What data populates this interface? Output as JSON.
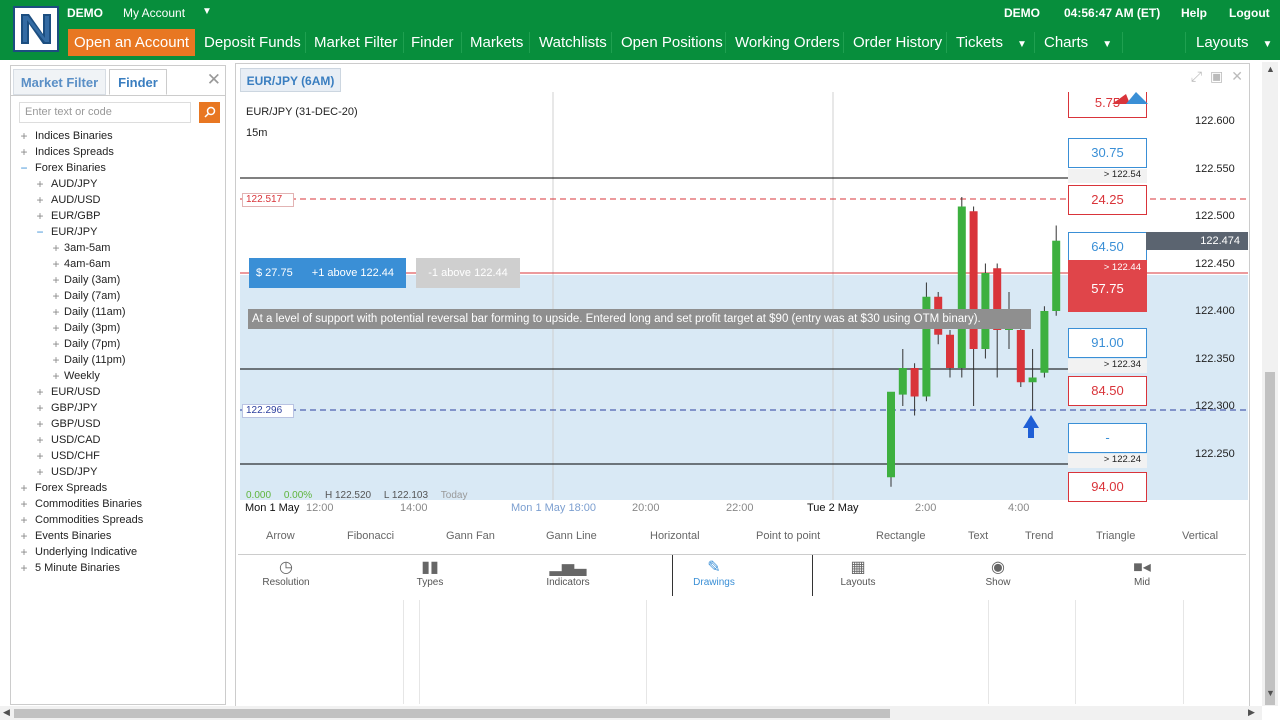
{
  "header": {
    "logo_icon": "nadex-n-logo",
    "demo_left": "DEMO",
    "my_account": "My Account",
    "demo_right": "DEMO",
    "time": "04:56:47 AM (ET)",
    "help": "Help",
    "logout": "Logout"
  },
  "nav": {
    "open_account": "Open an Account",
    "deposit": "Deposit Funds",
    "market_filter": "Market Filter",
    "finder": "Finder",
    "markets": "Markets",
    "watchlists": "Watchlists",
    "open_positions": "Open Positions",
    "working_orders": "Working Orders",
    "order_history": "Order History",
    "tickets": "Tickets",
    "charts": "Charts",
    "layouts": "Layouts"
  },
  "sidebar": {
    "tab_market_filter": "Market Filter",
    "tab_finder": "Finder",
    "search_placeholder": "Enter text or code",
    "tree": [
      {
        "label": "Indices Binaries",
        "level": 0,
        "exp": "+"
      },
      {
        "label": "Indices Spreads",
        "level": 0,
        "exp": "+"
      },
      {
        "label": "Forex Binaries",
        "level": 0,
        "exp": "−"
      },
      {
        "label": "AUD/JPY",
        "level": 1,
        "exp": "+"
      },
      {
        "label": "AUD/USD",
        "level": 1,
        "exp": "+"
      },
      {
        "label": "EUR/GBP",
        "level": 1,
        "exp": "+"
      },
      {
        "label": "EUR/JPY",
        "level": 1,
        "exp": "−"
      },
      {
        "label": "3am-5am",
        "level": 2,
        "exp": "+"
      },
      {
        "label": "4am-6am",
        "level": 2,
        "exp": "+"
      },
      {
        "label": "Daily (3am)",
        "level": 2,
        "exp": "+"
      },
      {
        "label": "Daily (7am)",
        "level": 2,
        "exp": "+"
      },
      {
        "label": "Daily (11am)",
        "level": 2,
        "exp": "+"
      },
      {
        "label": "Daily (3pm)",
        "level": 2,
        "exp": "+"
      },
      {
        "label": "Daily (7pm)",
        "level": 2,
        "exp": "+"
      },
      {
        "label": "Daily (11pm)",
        "level": 2,
        "exp": "+"
      },
      {
        "label": "Weekly",
        "level": 2,
        "exp": "+"
      },
      {
        "label": "EUR/USD",
        "level": 1,
        "exp": "+"
      },
      {
        "label": "GBP/JPY",
        "level": 1,
        "exp": "+"
      },
      {
        "label": "GBP/USD",
        "level": 1,
        "exp": "+"
      },
      {
        "label": "USD/CAD",
        "level": 1,
        "exp": "+"
      },
      {
        "label": "USD/CHF",
        "level": 1,
        "exp": "+"
      },
      {
        "label": "USD/JPY",
        "level": 1,
        "exp": "+"
      },
      {
        "label": "Forex Spreads",
        "level": 0,
        "exp": "+"
      },
      {
        "label": "Commodities Binaries",
        "level": 0,
        "exp": "+"
      },
      {
        "label": "Commodities Spreads",
        "level": 0,
        "exp": "+"
      },
      {
        "label": "Events Binaries",
        "level": 0,
        "exp": "+"
      },
      {
        "label": "Underlying Indicative",
        "level": 0,
        "exp": "+"
      },
      {
        "label": "5 Minute Binaries",
        "level": 0,
        "exp": "+"
      }
    ]
  },
  "chart_panel": {
    "tab_title": "EUR/JPY (6AM)",
    "instrument": "EUR/JPY (31-DEC-20)",
    "timeframe": "15m",
    "left_tag_top": "122.517",
    "left_tag_bottom": "122.296",
    "order_buy": "$ 27.75",
    "order_buy_desc": "+1 above 122.44",
    "order_sell_desc": "-1 above 122.44",
    "annotation": "At a level of support with potential reversal bar forming to upside.  Entered long and set profit target at $90 (entry was at $30 using OTM binary).",
    "ohlc_footer": {
      "v1": "0.000",
      "v2": "0.00%",
      "high": "H 122.520",
      "low": "L 122.103",
      "today": "Today"
    },
    "price_axis": [
      "122.600",
      "122.550",
      "122.500",
      "122.450",
      "122.400",
      "122.350",
      "122.300",
      "122.250"
    ],
    "current_price": "122.474",
    "time_axis": [
      "Mon 1 May",
      "12:00",
      "14:00",
      "Mon 1 May 18:00",
      "20:00",
      "22:00",
      "Tue 2 May",
      "2:00",
      "4:00"
    ],
    "ladder": [
      {
        "price": "5.75",
        "strike": "",
        "color": "red"
      },
      {
        "price": "30.75",
        "strike": "> 122.54",
        "color": "blue"
      },
      {
        "price": "24.25",
        "strike": "",
        "color": "red"
      },
      {
        "price": "64.50",
        "strike": "> 122.44",
        "color": "blue"
      },
      {
        "price": "57.75",
        "strike": "",
        "color": "redfill"
      },
      {
        "price": "91.00",
        "strike": "> 122.34",
        "color": "blue"
      },
      {
        "price": "84.50",
        "strike": "",
        "color": "red"
      },
      {
        "price": "-",
        "strike": "> 122.24",
        "color": "blue"
      },
      {
        "price": "94.00",
        "strike": "",
        "color": "red"
      }
    ],
    "candles": [
      {
        "t": "01:45",
        "o": 122.225,
        "h": 122.235,
        "l": 122.215,
        "c": 122.315
      },
      {
        "t": "02:00",
        "o": 122.312,
        "h": 122.36,
        "l": 122.3,
        "c": 122.34
      },
      {
        "t": "02:15",
        "o": 122.34,
        "h": 122.345,
        "l": 122.29,
        "c": 122.31
      },
      {
        "t": "02:30",
        "o": 122.31,
        "h": 122.43,
        "l": 122.305,
        "c": 122.415
      },
      {
        "t": "02:45",
        "o": 122.415,
        "h": 122.42,
        "l": 122.365,
        "c": 122.375
      },
      {
        "t": "03:00",
        "o": 122.375,
        "h": 122.38,
        "l": 122.33,
        "c": 122.34
      },
      {
        "t": "03:15",
        "o": 122.34,
        "h": 122.52,
        "l": 122.33,
        "c": 122.51
      },
      {
        "t": "03:30",
        "o": 122.505,
        "h": 122.51,
        "l": 122.3,
        "c": 122.36
      },
      {
        "t": "03:45",
        "o": 122.36,
        "h": 122.45,
        "l": 122.35,
        "c": 122.44
      },
      {
        "t": "04:00",
        "o": 122.445,
        "h": 122.45,
        "l": 122.33,
        "c": 122.38
      },
      {
        "t": "04:15",
        "o": 122.38,
        "h": 122.42,
        "l": 122.36,
        "c": 122.4
      },
      {
        "t": "04:30",
        "o": 122.38,
        "h": 122.385,
        "l": 122.32,
        "c": 122.325
      },
      {
        "t": "04:45",
        "o": 122.325,
        "h": 122.36,
        "l": 122.295,
        "c": 122.33
      },
      {
        "t": "05:00",
        "o": 122.335,
        "h": 122.405,
        "l": 122.33,
        "c": 122.4
      },
      {
        "t": "05:15",
        "o": 122.4,
        "h": 122.49,
        "l": 122.395,
        "c": 122.474
      }
    ]
  },
  "drawing_tools": [
    "Arrow",
    "Fibonacci",
    "Gann Fan",
    "Gann Line",
    "Horizontal",
    "Point to point",
    "Rectangle",
    "Text",
    "Trend",
    "Triangle",
    "Vertical"
  ],
  "bottom_tabs": [
    {
      "label": "Resolution",
      "icon": "clock-icon"
    },
    {
      "label": "Types",
      "icon": "candlestick-icon"
    },
    {
      "label": "Indicators",
      "icon": "bar-chart-icon"
    },
    {
      "label": "Drawings",
      "icon": "pencil-icon"
    },
    {
      "label": "Layouts",
      "icon": "layout-grid-icon"
    },
    {
      "label": "Show",
      "icon": "eye-icon"
    },
    {
      "label": "Mid",
      "icon": "camera-icon"
    }
  ],
  "colors": {
    "brand_green": "#078e3c",
    "accent_orange": "#e87722",
    "bull": "#3db03f",
    "bear": "#d9343a",
    "link_blue": "#3a7ec0"
  }
}
